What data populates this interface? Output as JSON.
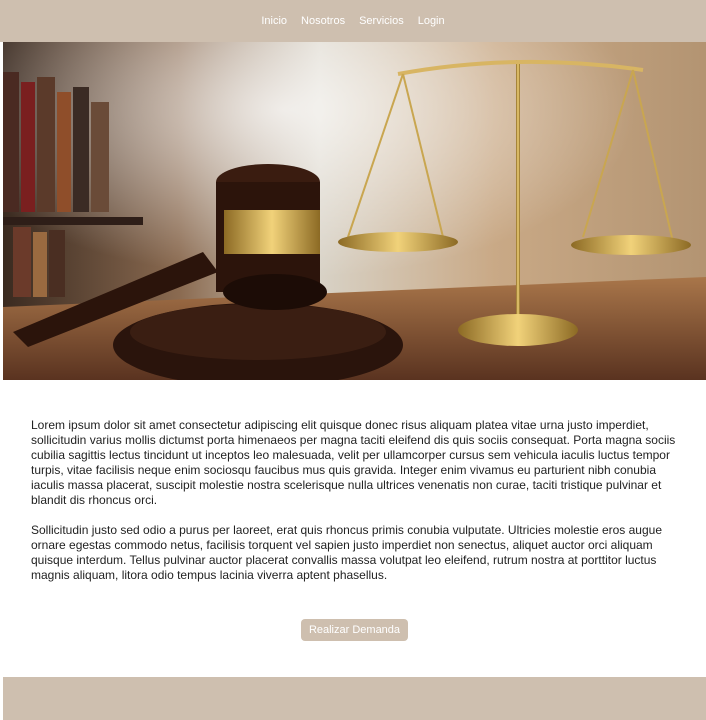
{
  "nav": {
    "items": [
      "Inicio",
      "Nosotros",
      "Servicios",
      "Login"
    ]
  },
  "hero": {
    "image_subject": "judge-gavel-and-scales"
  },
  "content": {
    "paragraphs": [
      "Lorem ipsum dolor sit amet consectetur adipiscing elit quisque donec risus aliquam platea vitae urna justo imperdiet, sollicitudin varius mollis dictumst porta himenaeos per magna taciti eleifend dis quis sociis consequat. Porta magna sociis cubilia sagittis lectus tincidunt ut inceptos leo malesuada, velit per ullamcorper cursus sem vehicula iaculis luctus tempor turpis, vitae facilisis neque enim sociosqu faucibus mus quis gravida. Integer enim vivamus eu parturient nibh conubia iaculis massa placerat, suscipit molestie nostra scelerisque nulla ultrices venenatis non curae, taciti tristique pulvinar et blandit dis rhoncus orci.",
      "Sollicitudin justo sed odio a purus per laoreet, erat quis rhoncus primis conubia vulputate. Ultricies molestie eros augue ornare egestas commodo netus, facilisis torquent vel sapien justo imperdiet non senectus, aliquet auctor orci aliquam quisque interdum. Tellus pulvinar auctor placerat convallis massa volutpat leo eleifend, rutrum nostra at porttitor luctus magnis aliquam, litora odio tempus lacinia viverra aptent phasellus."
    ]
  },
  "cta": {
    "label": "Realizar Demanda"
  },
  "colors": {
    "accent": "#cebfaf",
    "text": "#222222",
    "background": "#ffffff"
  }
}
